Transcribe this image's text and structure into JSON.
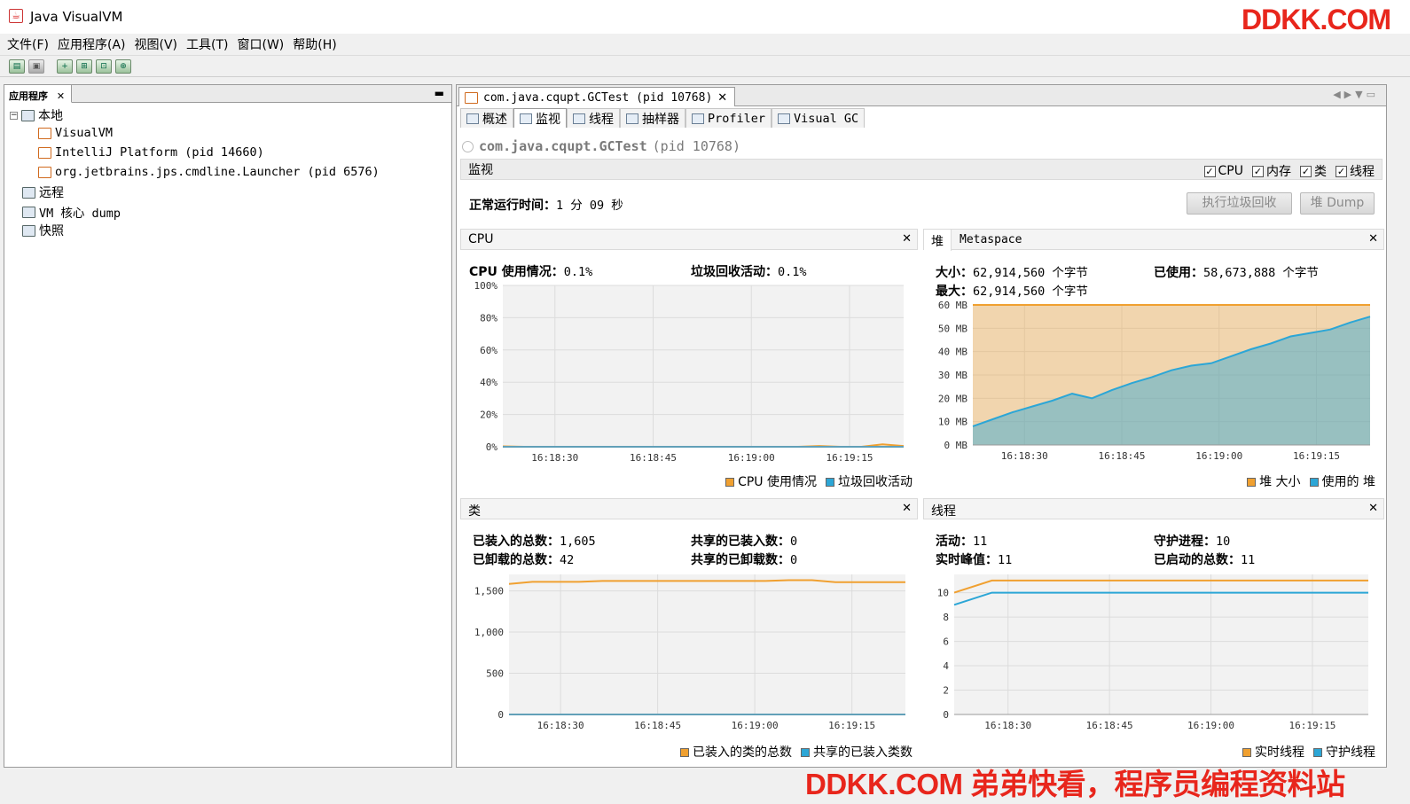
{
  "window": {
    "title": "Java VisualVM",
    "watermark_top": "DDKK.COM",
    "watermark_bottom": "DDKK.COM 弟弟快看，程序员编程资料站"
  },
  "menu": [
    "文件(F)",
    "应用程序(A)",
    "视图(V)",
    "工具(T)",
    "窗口(W)",
    "帮助(H)"
  ],
  "left": {
    "tab_label": "应用程序",
    "tree": [
      {
        "label": "本地"
      },
      {
        "label": "VisualVM"
      },
      {
        "label": "IntelliJ Platform (pid 14660)"
      },
      {
        "label": "org.jetbrains.jps.cmdline.Launcher (pid 6576)"
      },
      {
        "label": "远程"
      },
      {
        "label": "VM 核心 dump"
      },
      {
        "label": "快照"
      }
    ]
  },
  "doc": {
    "tab_label": "com.java.cqupt.GCTest (pid 10768)",
    "subtabs": [
      "概述",
      "监视",
      "线程",
      "抽样器",
      "Profiler",
      "Visual GC"
    ],
    "process_name": "com.java.cqupt.GCTest",
    "process_pid": "(pid 10768)"
  },
  "monitor": {
    "title": "监视",
    "checks": [
      "CPU",
      "内存",
      "类",
      "线程"
    ],
    "uptime_label": "正常运行时间：",
    "uptime_value": "1 分 09 秒",
    "gc_button": "执行垃圾回收",
    "dump_button": "堆 Dump"
  },
  "cpu": {
    "title": "CPU",
    "usage_label": "CPU 使用情况：",
    "usage_value": "0.1%",
    "gc_label": "垃圾回收活动：",
    "gc_value": "0.1%",
    "legend": [
      "CPU 使用情况",
      "垃圾回收活动"
    ]
  },
  "heap": {
    "tabs": [
      "堆",
      "Metaspace"
    ],
    "size_label": "大小：",
    "size_value": "62,914,560 个字节",
    "used_label": "已使用：",
    "used_value": "58,673,888 个字节",
    "max_label": "最大：",
    "max_value": "62,914,560 个字节",
    "legend": [
      "堆 大小",
      "使用的 堆"
    ]
  },
  "classes": {
    "title": "类",
    "loaded_label": "已装入的总数：",
    "loaded_value": "1,605",
    "unloaded_label": "已卸载的总数：",
    "unloaded_value": "42",
    "shared_loaded_label": "共享的已装入数：",
    "shared_loaded_value": "0",
    "shared_unloaded_label": "共享的已卸载数：",
    "shared_unloaded_value": "0",
    "legend": [
      "已装入的类的总数",
      "共享的已装入类数"
    ]
  },
  "threads": {
    "title": "线程",
    "live_label": "活动：",
    "live_value": "11",
    "daemon_label": "守护进程：",
    "daemon_value": "10",
    "peak_label": "实时峰值：",
    "peak_value": "11",
    "started_label": "已启动的总数：",
    "started_value": "11",
    "legend": [
      "实时线程",
      "守护线程"
    ]
  },
  "colors": {
    "orange": "#f0a030",
    "blue": "#2ca6d6"
  },
  "chart_data": [
    {
      "type": "line",
      "name": "CPU",
      "x_ticks": [
        "16:18:30",
        "16:18:45",
        "16:19:00",
        "16:19:15"
      ],
      "y_ticks": [
        "0%",
        "20%",
        "40%",
        "60%",
        "80%",
        "100%"
      ],
      "ylim": [
        0,
        100
      ],
      "series": [
        {
          "name": "CPU 使用情况",
          "color": "#f0a030",
          "values": [
            0.3,
            0,
            0,
            0,
            0,
            0,
            0,
            0,
            0,
            0,
            0,
            0,
            0,
            0,
            0,
            0.5,
            0,
            0,
            1.5,
            0.5
          ]
        },
        {
          "name": "垃圾回收活动",
          "color": "#2ca6d6",
          "values": [
            0,
            0,
            0,
            0,
            0,
            0,
            0,
            0,
            0,
            0,
            0,
            0,
            0,
            0,
            0,
            0,
            0,
            0,
            0,
            0
          ]
        }
      ]
    },
    {
      "type": "area",
      "name": "堆",
      "x_ticks": [
        "16:18:30",
        "16:18:45",
        "16:19:00",
        "16:19:15"
      ],
      "y_ticks": [
        "0 MB",
        "10 MB",
        "20 MB",
        "30 MB",
        "40 MB",
        "50 MB",
        "60 MB"
      ],
      "ylim": [
        0,
        60
      ],
      "series": [
        {
          "name": "堆 大小",
          "color": "#f0a030",
          "values": [
            60,
            60,
            60,
            60,
            60,
            60,
            60,
            60,
            60,
            60,
            60,
            60,
            60,
            60,
            60,
            60,
            60,
            60,
            60,
            60,
            60
          ]
        },
        {
          "name": "使用的 堆",
          "color": "#2ca6d6",
          "values": [
            8,
            11,
            14,
            16.5,
            19,
            22,
            20,
            23.5,
            26.5,
            29,
            32,
            34,
            35,
            38,
            41,
            43.5,
            46.5,
            48,
            49.5,
            52.5,
            55
          ]
        }
      ]
    },
    {
      "type": "line",
      "name": "类",
      "x_ticks": [
        "16:18:30",
        "16:18:45",
        "16:19:00",
        "16:19:15"
      ],
      "y_ticks": [
        "0",
        "500",
        "1,000",
        "1,500"
      ],
      "ylim": [
        0,
        1700
      ],
      "series": [
        {
          "name": "已装入的类的总数",
          "color": "#f0a030",
          "values": [
            1585,
            1610,
            1610,
            1610,
            1620,
            1620,
            1620,
            1620,
            1620,
            1620,
            1620,
            1620,
            1630,
            1630,
            1605,
            1605,
            1605,
            1605
          ]
        },
        {
          "name": "共享的已装入类数",
          "color": "#2ca6d6",
          "values": [
            0,
            0,
            0,
            0,
            0,
            0,
            0,
            0,
            0,
            0,
            0,
            0,
            0,
            0,
            0,
            0,
            0,
            0
          ]
        }
      ]
    },
    {
      "type": "line",
      "name": "线程",
      "x_ticks": [
        "16:18:30",
        "16:18:45",
        "16:19:00",
        "16:19:15"
      ],
      "y_ticks": [
        "0",
        "2",
        "4",
        "6",
        "8",
        "10"
      ],
      "ylim": [
        0,
        11.5
      ],
      "series": [
        {
          "name": "实时线程",
          "color": "#f0a030",
          "values": [
            10,
            11,
            11,
            11,
            11,
            11,
            11,
            11,
            11,
            11,
            11,
            11
          ]
        },
        {
          "name": "守护线程",
          "color": "#2ca6d6",
          "values": [
            9,
            10,
            10,
            10,
            10,
            10,
            10,
            10,
            10,
            10,
            10,
            10
          ]
        }
      ]
    }
  ]
}
